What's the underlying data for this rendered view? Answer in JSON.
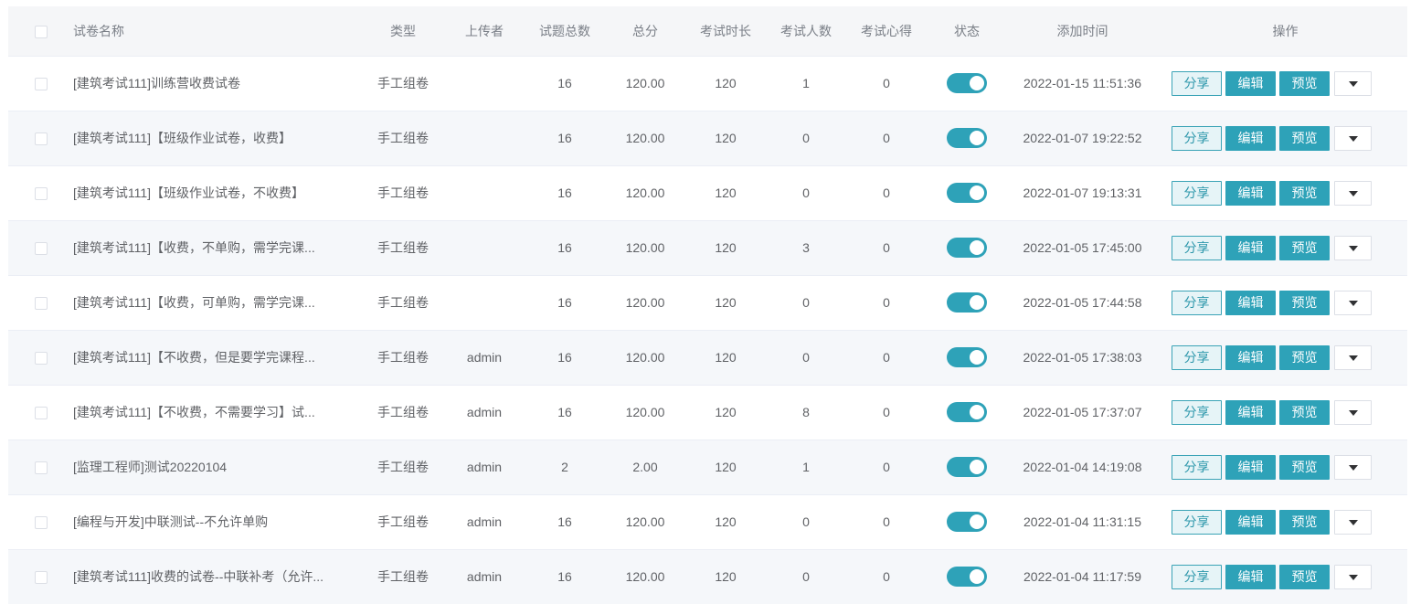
{
  "colors": {
    "accent": "#2ea2b8",
    "toggle_on": "#2ea2b8"
  },
  "header": {
    "name": "试卷名称",
    "type": "类型",
    "uploader": "上传者",
    "total_questions": "试题总数",
    "total_score": "总分",
    "duration": "考试时长",
    "examinees": "考试人数",
    "experience": "考试心得",
    "status": "状态",
    "added_time": "添加时间",
    "actions": "操作"
  },
  "actions": {
    "share": "分享",
    "edit": "编辑",
    "preview": "预览",
    "more_icon": "triangle-down-icon"
  },
  "rows": [
    {
      "name": "[建筑考试111]训练营收费试卷",
      "type": "手工组卷",
      "uploader": "",
      "total_questions": "16",
      "total_score": "120.00",
      "duration": "120",
      "examinees": "1",
      "experience": "0",
      "status_on": true,
      "added_time": "2022-01-15 11:51:36"
    },
    {
      "name": "[建筑考试111]【班级作业试卷，收费】",
      "type": "手工组卷",
      "uploader": "",
      "total_questions": "16",
      "total_score": "120.00",
      "duration": "120",
      "examinees": "0",
      "experience": "0",
      "status_on": true,
      "added_time": "2022-01-07 19:22:52"
    },
    {
      "name": "[建筑考试111]【班级作业试卷，不收费】",
      "type": "手工组卷",
      "uploader": "",
      "total_questions": "16",
      "total_score": "120.00",
      "duration": "120",
      "examinees": "0",
      "experience": "0",
      "status_on": true,
      "added_time": "2022-01-07 19:13:31"
    },
    {
      "name": "[建筑考试111]【收费，不单购，需学完课...",
      "type": "手工组卷",
      "uploader": "",
      "total_questions": "16",
      "total_score": "120.00",
      "duration": "120",
      "examinees": "3",
      "experience": "0",
      "status_on": true,
      "added_time": "2022-01-05 17:45:00"
    },
    {
      "name": "[建筑考试111]【收费，可单购，需学完课...",
      "type": "手工组卷",
      "uploader": "",
      "total_questions": "16",
      "total_score": "120.00",
      "duration": "120",
      "examinees": "0",
      "experience": "0",
      "status_on": true,
      "added_time": "2022-01-05 17:44:58"
    },
    {
      "name": "[建筑考试111]【不收费，但是要学完课程...",
      "type": "手工组卷",
      "uploader": "admin",
      "total_questions": "16",
      "total_score": "120.00",
      "duration": "120",
      "examinees": "0",
      "experience": "0",
      "status_on": true,
      "added_time": "2022-01-05 17:38:03"
    },
    {
      "name": "[建筑考试111]【不收费，不需要学习】试...",
      "type": "手工组卷",
      "uploader": "admin",
      "total_questions": "16",
      "total_score": "120.00",
      "duration": "120",
      "examinees": "8",
      "experience": "0",
      "status_on": true,
      "added_time": "2022-01-05 17:37:07"
    },
    {
      "name": "[监理工程师]测试20220104",
      "type": "手工组卷",
      "uploader": "admin",
      "total_questions": "2",
      "total_score": "2.00",
      "duration": "120",
      "examinees": "1",
      "experience": "0",
      "status_on": true,
      "added_time": "2022-01-04 14:19:08"
    },
    {
      "name": "[编程与开发]中联测试--不允许单购",
      "type": "手工组卷",
      "uploader": "admin",
      "total_questions": "16",
      "total_score": "120.00",
      "duration": "120",
      "examinees": "0",
      "experience": "0",
      "status_on": true,
      "added_time": "2022-01-04 11:31:15"
    },
    {
      "name": "[建筑考试111]收费的试卷--中联补考（允许...",
      "type": "手工组卷",
      "uploader": "admin",
      "total_questions": "16",
      "total_score": "120.00",
      "duration": "120",
      "examinees": "0",
      "experience": "0",
      "status_on": true,
      "added_time": "2022-01-04 11:17:59"
    }
  ]
}
